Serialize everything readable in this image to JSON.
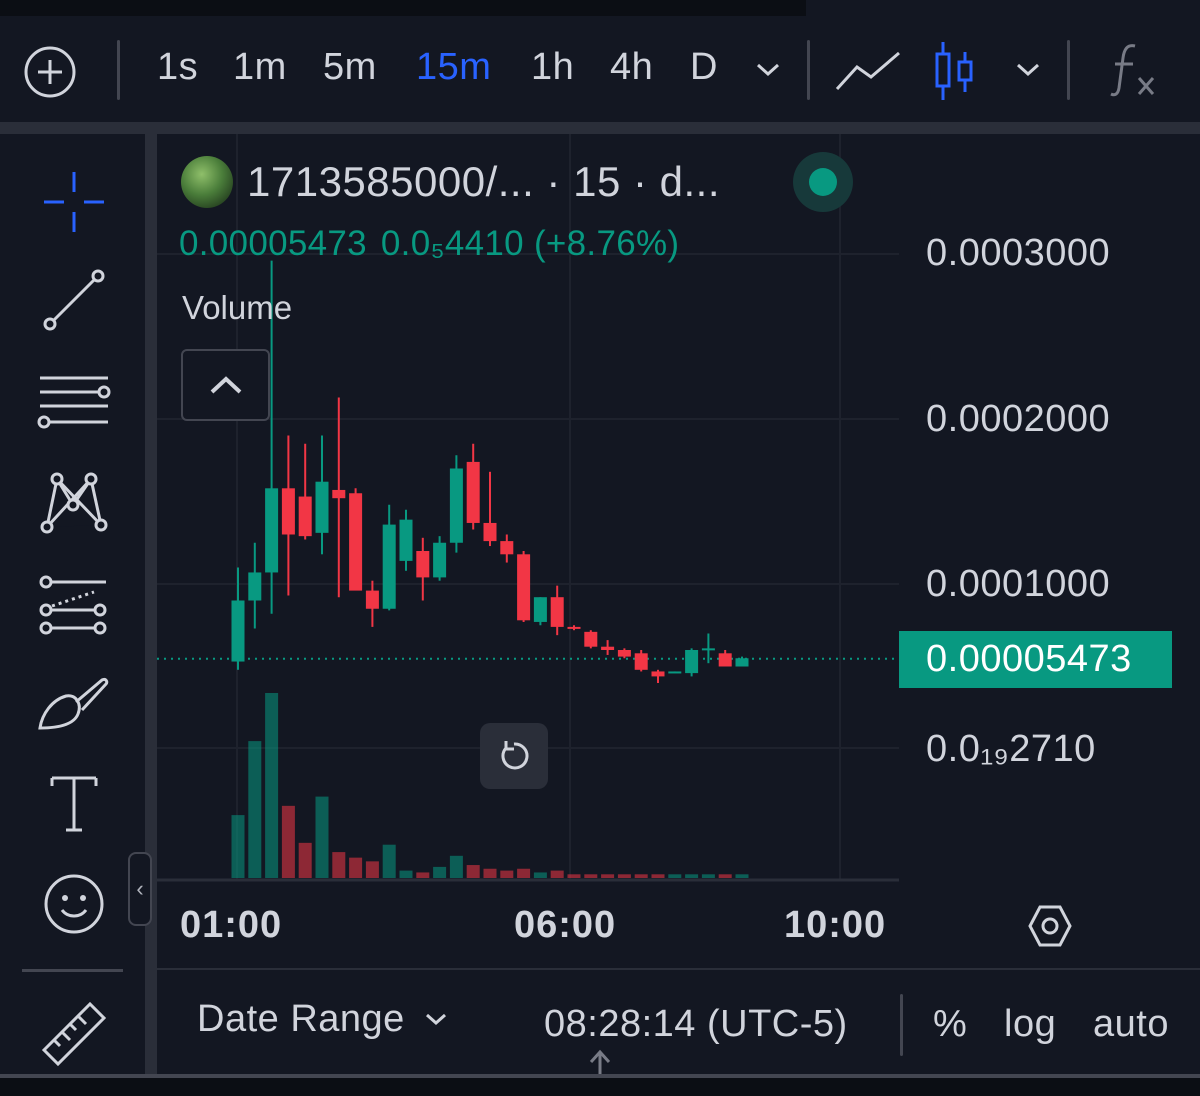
{
  "toolbar": {
    "timeframes": [
      "1s",
      "1m",
      "5m",
      "15m",
      "1h",
      "4h",
      "D"
    ],
    "active_timeframe": "15m"
  },
  "legend": {
    "symbol": "1713585000/... · 15 · d...",
    "last_price": "0.00005473",
    "change": "0.0₅4410 (+8.76%)",
    "volume_label": "Volume"
  },
  "price_axis": {
    "labels": [
      "0.0003000",
      "0.0002000",
      "0.0001000",
      "0.0₁₉2710"
    ],
    "current_price": "0.00005473"
  },
  "time_axis": {
    "labels": [
      "01:00",
      "06:00",
      "10:00"
    ]
  },
  "bottom": {
    "date_range": "Date Range",
    "clock": "08:28:14 (UTC-5)",
    "percent": "%",
    "log": "log",
    "auto": "auto"
  },
  "colors": {
    "up": "#089981",
    "down": "#f23645",
    "accent": "#2962ff",
    "background": "#131722"
  },
  "chart_data": {
    "type": "candlestick",
    "title": "",
    "price_ylim": [
      2.7e-05,
      0.00035
    ],
    "price_ticks": [
      0.0003,
      0.0002,
      0.0001
    ],
    "x_ticks": [
      "01:00",
      "06:00",
      "10:00"
    ],
    "interval": "15m",
    "candles": [
      {
        "o": 5.3e-05,
        "h": 0.00011,
        "l": 4.8e-05,
        "c": 9e-05
      },
      {
        "o": 9e-05,
        "h": 0.000125,
        "l": 7.3e-05,
        "c": 0.000107
      },
      {
        "o": 0.000107,
        "h": 0.000296,
        "l": 8.2e-05,
        "c": 0.000158
      },
      {
        "o": 0.000158,
        "h": 0.00019,
        "l": 9.3e-05,
        "c": 0.00013
      },
      {
        "o": 0.000153,
        "h": 0.000185,
        "l": 0.000127,
        "c": 0.000129
      },
      {
        "o": 0.000131,
        "h": 0.00019,
        "l": 0.000118,
        "c": 0.000162
      },
      {
        "o": 0.000157,
        "h": 0.000213,
        "l": 9.2e-05,
        "c": 0.000152
      },
      {
        "o": 0.000155,
        "h": 0.000158,
        "l": 0.0001,
        "c": 9.6e-05
      },
      {
        "o": 9.6e-05,
        "h": 0.000102,
        "l": 7.4e-05,
        "c": 8.5e-05
      },
      {
        "o": 8.5e-05,
        "h": 0.000148,
        "l": 8.4e-05,
        "c": 0.000136
      },
      {
        "o": 0.000114,
        "h": 0.000145,
        "l": 0.000108,
        "c": 0.000139
      },
      {
        "o": 0.00012,
        "h": 0.000128,
        "l": 9e-05,
        "c": 0.000104
      },
      {
        "o": 0.000104,
        "h": 0.000129,
        "l": 0.000102,
        "c": 0.000125
      },
      {
        "o": 0.000125,
        "h": 0.000178,
        "l": 0.000119,
        "c": 0.00017
      },
      {
        "o": 0.000174,
        "h": 0.000185,
        "l": 0.000133,
        "c": 0.000137
      },
      {
        "o": 0.000137,
        "h": 0.000168,
        "l": 0.000123,
        "c": 0.000126
      },
      {
        "o": 0.000126,
        "h": 0.00013,
        "l": 0.000113,
        "c": 0.000118
      },
      {
        "o": 0.000118,
        "h": 0.00012,
        "l": 7.7e-05,
        "c": 7.8e-05
      },
      {
        "o": 7.7e-05,
        "h": 9.2e-05,
        "l": 7.5e-05,
        "c": 9.2e-05
      },
      {
        "o": 9.2e-05,
        "h": 9.9e-05,
        "l": 6.9e-05,
        "c": 7.4e-05
      },
      {
        "o": 7.4e-05,
        "h": 7.5e-05,
        "l": 7.2e-05,
        "c": 7.3e-05
      },
      {
        "o": 7.1e-05,
        "h": 7.2e-05,
        "l": 6.1e-05,
        "c": 6.2e-05
      },
      {
        "o": 6.2e-05,
        "h": 6.6e-05,
        "l": 5.7e-05,
        "c": 6e-05
      },
      {
        "o": 6e-05,
        "h": 6.1e-05,
        "l": 5.5e-05,
        "c": 5.6e-05
      },
      {
        "o": 5.8e-05,
        "h": 6e-05,
        "l": 4.7e-05,
        "c": 4.8e-05
      },
      {
        "o": 4.7e-05,
        "h": 4.8e-05,
        "l": 4e-05,
        "c": 4.4e-05
      },
      {
        "o": 4.6e-05,
        "h": 4.7e-05,
        "l": 4.6e-05,
        "c": 4.7e-05
      },
      {
        "o": 4.6e-05,
        "h": 6.1e-05,
        "l": 4.4e-05,
        "c": 6e-05
      },
      {
        "o": 6.1e-05,
        "h": 7e-05,
        "l": 5.2e-05,
        "c": 6.1e-05
      },
      {
        "o": 5.8e-05,
        "h": 6e-05,
        "l": 5e-05,
        "c": 5e-05
      },
      {
        "o": 5e-05,
        "h": 5.6e-05,
        "l": 5e-05,
        "c": 5.5e-05
      }
    ],
    "volume": [
      0.34,
      0.74,
      1.0,
      0.39,
      0.19,
      0.44,
      0.14,
      0.11,
      0.09,
      0.18,
      0.04,
      0.03,
      0.06,
      0.12,
      0.07,
      0.05,
      0.04,
      0.05,
      0.03,
      0.04,
      0.02,
      0.02,
      0.02,
      0.02,
      0.02,
      0.02,
      0.02,
      0.02,
      0.02,
      0.02,
      0.02
    ]
  }
}
